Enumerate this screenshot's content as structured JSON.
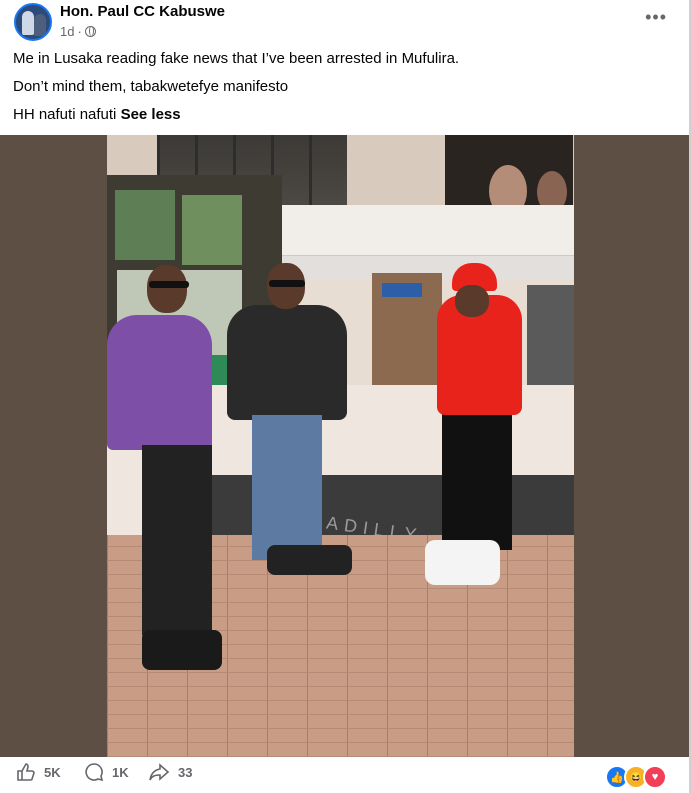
{
  "post": {
    "author": "Hon. Paul CC Kabuswe",
    "time": "1d",
    "text_lines": [
      "Me in Lusaka reading fake news that I’ve been arrested in Mufulira.",
      "Don’t mind them, tabakwetefye manifesto",
      "HH nafuti nafuti"
    ],
    "see_less_label": "See less",
    "more_icon": "more-options-icon",
    "photo_text": "PICCADILLY SHOPPING MALL"
  },
  "footer": {
    "likes": "5K",
    "comments": "1K",
    "shares": "33",
    "reactions": [
      "like",
      "haha",
      "love"
    ]
  },
  "colors": {
    "accent": "#1877f2",
    "text": "#050505",
    "secondary": "#65676b"
  }
}
